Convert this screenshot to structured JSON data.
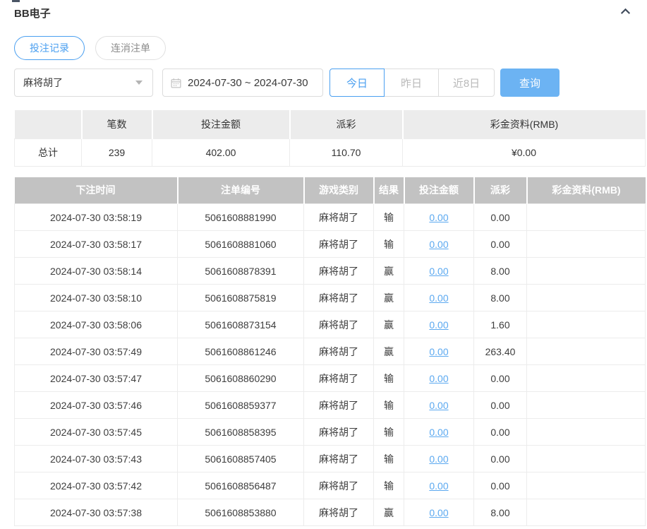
{
  "panel": {
    "title": "BB电子",
    "collapse_icon": "chevron-up-icon"
  },
  "tabs": [
    {
      "label": "投注记录",
      "active": true
    },
    {
      "label": "连消注单",
      "active": false
    }
  ],
  "toolbar": {
    "game_select": {
      "value": "麻将胡了",
      "icon": "caret-down-icon"
    },
    "date_range": {
      "value": "2024-07-30 ~ 2024-07-30",
      "icon": "calendar-icon"
    },
    "quick_buttons": [
      {
        "label": "今日",
        "active": true
      },
      {
        "label": "昨日",
        "active": false
      },
      {
        "label": "近8日",
        "active": false
      }
    ],
    "query_label": "查询"
  },
  "summary_table": {
    "headers": [
      "",
      "笔数",
      "投注金额",
      "派彩",
      "彩金资料(RMB)"
    ],
    "total_row": {
      "label": "总计",
      "count": "239",
      "bet_amount": "402.00",
      "payout": "110.70",
      "jackpot": "¥0.00"
    }
  },
  "records_table": {
    "headers": [
      "下注时间",
      "注单编号",
      "游戏类别",
      "结果",
      "投注金额",
      "派彩",
      "彩金资料(RMB)"
    ],
    "rows": [
      {
        "time": "2024-07-30 03:58:19",
        "order_no": "5061608881990",
        "game": "麻将胡了",
        "result": "输",
        "bet_amount": "0.00",
        "payout": "0.00",
        "jackpot": ""
      },
      {
        "time": "2024-07-30 03:58:17",
        "order_no": "5061608881060",
        "game": "麻将胡了",
        "result": "输",
        "bet_amount": "0.00",
        "payout": "0.00",
        "jackpot": ""
      },
      {
        "time": "2024-07-30 03:58:14",
        "order_no": "5061608878391",
        "game": "麻将胡了",
        "result": "赢",
        "bet_amount": "0.00",
        "payout": "8.00",
        "jackpot": ""
      },
      {
        "time": "2024-07-30 03:58:10",
        "order_no": "5061608875819",
        "game": "麻将胡了",
        "result": "赢",
        "bet_amount": "0.00",
        "payout": "8.00",
        "jackpot": ""
      },
      {
        "time": "2024-07-30 03:58:06",
        "order_no": "5061608873154",
        "game": "麻将胡了",
        "result": "赢",
        "bet_amount": "0.00",
        "payout": "1.60",
        "jackpot": ""
      },
      {
        "time": "2024-07-30 03:57:49",
        "order_no": "5061608861246",
        "game": "麻将胡了",
        "result": "赢",
        "bet_amount": "0.00",
        "payout": "263.40",
        "jackpot": ""
      },
      {
        "time": "2024-07-30 03:57:47",
        "order_no": "5061608860290",
        "game": "麻将胡了",
        "result": "输",
        "bet_amount": "0.00",
        "payout": "0.00",
        "jackpot": ""
      },
      {
        "time": "2024-07-30 03:57:46",
        "order_no": "5061608859377",
        "game": "麻将胡了",
        "result": "输",
        "bet_amount": "0.00",
        "payout": "0.00",
        "jackpot": ""
      },
      {
        "time": "2024-07-30 03:57:45",
        "order_no": "5061608858395",
        "game": "麻将胡了",
        "result": "输",
        "bet_amount": "0.00",
        "payout": "0.00",
        "jackpot": ""
      },
      {
        "time": "2024-07-30 03:57:43",
        "order_no": "5061608857405",
        "game": "麻将胡了",
        "result": "输",
        "bet_amount": "0.00",
        "payout": "0.00",
        "jackpot": ""
      },
      {
        "time": "2024-07-30 03:57:42",
        "order_no": "5061608856487",
        "game": "麻将胡了",
        "result": "输",
        "bet_amount": "0.00",
        "payout": "0.00",
        "jackpot": ""
      },
      {
        "time": "2024-07-30 03:57:38",
        "order_no": "5061608853880",
        "game": "麻将胡了",
        "result": "赢",
        "bet_amount": "0.00",
        "payout": "8.00",
        "jackpot": ""
      }
    ]
  },
  "colors": {
    "accent_blue": "#4a9ff0",
    "query_button_bg": "#6cb3f3",
    "link_blue": "#5ca9f0",
    "records_header_bg": "#c2c2c2",
    "summary_header_bg": "#ececec"
  }
}
